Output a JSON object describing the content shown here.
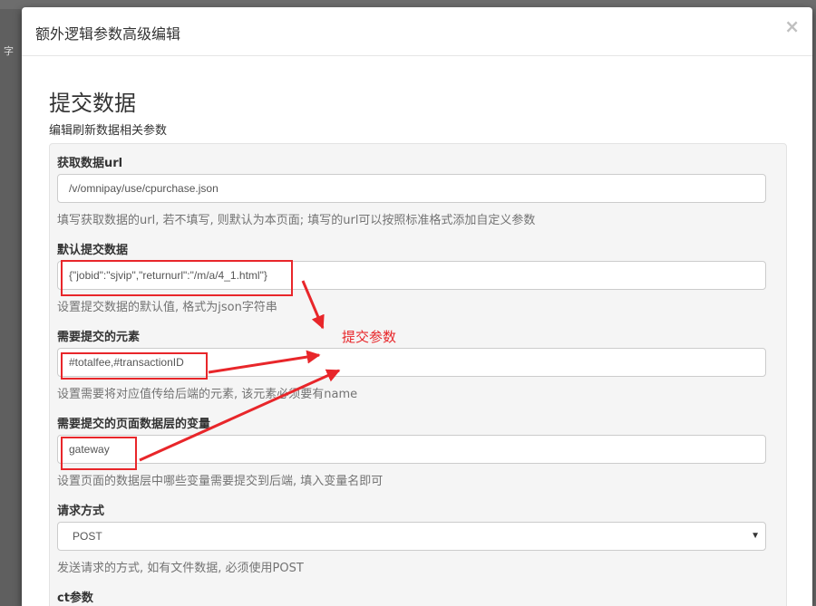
{
  "background": {
    "left_glyph": "字"
  },
  "modal": {
    "title": "额外逻辑参数高级编辑",
    "close_label": "×"
  },
  "section": {
    "title": "提交数据",
    "description": "编辑刷新数据相关参数"
  },
  "fields": [
    {
      "label": "获取数据url",
      "value": "/v/omnipay/use/cpurchase.json",
      "help": "填写获取数据的url, 若不填写, 则默认为本页面; 填写的url可以按照标准格式添加自定义参数"
    },
    {
      "label": "默认提交数据",
      "value": "{\"jobid\":\"sjvip\",\"returnurl\":\"/m/a/4_1.html\"}",
      "help": "设置提交数据的默认值, 格式为json字符串"
    },
    {
      "label": "需要提交的元素",
      "value": "#totalfee,#transactionID",
      "help": "设置需要将对应值传给后端的元素, 该元素必须要有name"
    },
    {
      "label": "需要提交的页面数据层的变量",
      "value": "gateway",
      "help": "设置页面的数据层中哪些变量需要提交到后端, 填入变量名即可"
    },
    {
      "label": "请求方式",
      "value": "POST",
      "help": "发送请求的方式, 如有文件数据, 必须使用POST"
    },
    {
      "label": "ct参数"
    }
  ],
  "annotation": {
    "text": "提交参数",
    "color": "#e8262a"
  },
  "colors": {
    "accent_red": "#e8262a",
    "panel_bg": "#f5f5f5"
  }
}
